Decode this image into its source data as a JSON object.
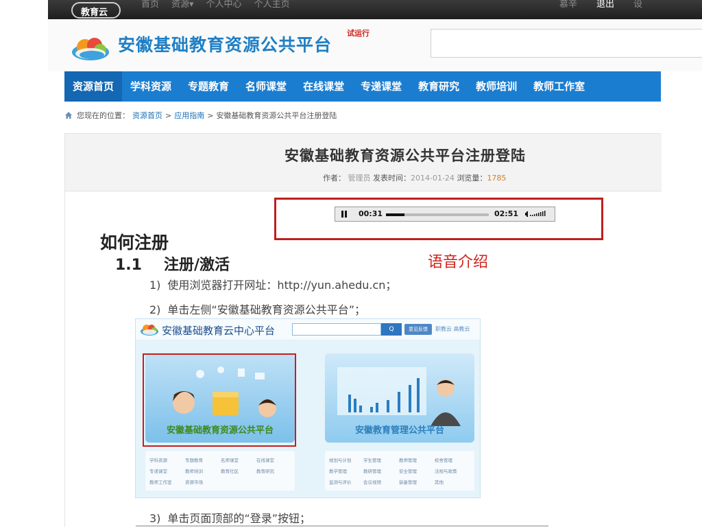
{
  "topbar": {
    "logo_text": "教育云",
    "nav": [
      "首页",
      "资源▾",
      "个人中心",
      "个人主页"
    ],
    "user": "慕辛",
    "logout": "退出",
    "settings": "设"
  },
  "header": {
    "site_title": "安徽基础教育资源公共平台",
    "trial_badge": "试运行"
  },
  "main_nav": [
    "资源首页",
    "学科资源",
    "专题教育",
    "名师课堂",
    "在线课堂",
    "专递课堂",
    "教育研究",
    "教师培训",
    "教师工作室"
  ],
  "breadcrumb": {
    "prefix": "您现在的位置：",
    "items": [
      "资源首页",
      "应用指南"
    ],
    "separator": ">",
    "current": "安徽基础教育资源公共平台注册登陆"
  },
  "article": {
    "title": "安徽基础教育资源公共平台注册登陆",
    "author_label": "作者：",
    "author": "管理员",
    "date_label": "发表时间：",
    "date": "2014-01-24",
    "views_label": "浏览量：",
    "views": "1785"
  },
  "audio": {
    "current_time": "00:31",
    "duration": "02:51",
    "progress_fraction": 0.18,
    "label": "语音介绍"
  },
  "doc": {
    "heading1": "如何注册",
    "heading2_num": "1.1",
    "heading2_text": "注册/激活",
    "steps": [
      {
        "n": "1)",
        "text": "使用浏览器打开网址：http://yun.ahedu.cn；"
      },
      {
        "n": "2)",
        "text": "单击左侧“安徽基础教育资源公共平台”；"
      },
      {
        "n": "3)",
        "text": "单击页面顶部的“登录”按钮；"
      }
    ]
  },
  "screenshot": {
    "title": "安徽基础教育云中心平台",
    "search_btn": "Q",
    "btn2": "意见反馈",
    "links": "职教云  高教云",
    "left_label": "安徽基础教育资源公共平台",
    "right_label": "安徽教育管理公共平台",
    "left_links": [
      "学科资源",
      "专题教育",
      "名师课堂",
      "在线课堂",
      "专递课堂",
      "教师培训",
      "教育社区",
      "教育研究",
      "教师工作室",
      "资源市场"
    ],
    "right_links": [
      "规划与计划",
      "学生管理",
      "教师管理",
      "校舍管理",
      "教学管理",
      "教研管理",
      "安全管理",
      "法规与政策",
      "监测与评价",
      "会议视频",
      "装备管理",
      "其他"
    ]
  },
  "colors": {
    "brand_blue": "#1b7dd0",
    "highlight_red": "#bf1e1e",
    "views_orange": "#e07b12"
  }
}
